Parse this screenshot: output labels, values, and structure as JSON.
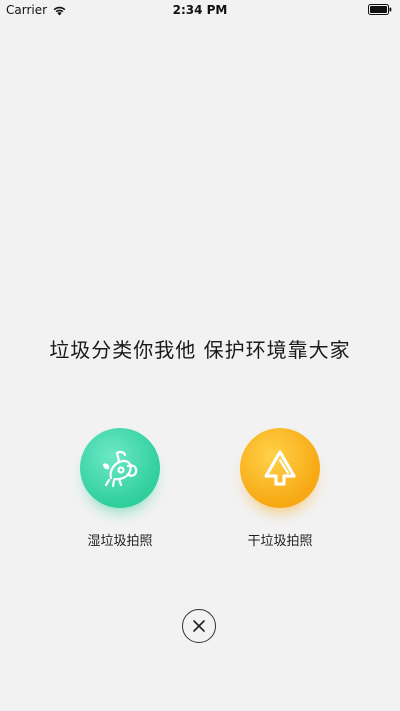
{
  "status_bar": {
    "carrier": "Carrier",
    "time": "2:34 PM",
    "wifi_icon": "wifi-icon",
    "battery_icon": "battery-icon"
  },
  "slogan": "垃圾分类你我他 保护环境靠大家",
  "actions": [
    {
      "label": "湿垃圾拍照",
      "icon": "wet-waste-icon",
      "color": "#2fcf9c"
    },
    {
      "label": "干垃圾拍照",
      "icon": "dry-waste-icon",
      "color": "#f7a812"
    }
  ],
  "close_icon": "close-icon"
}
